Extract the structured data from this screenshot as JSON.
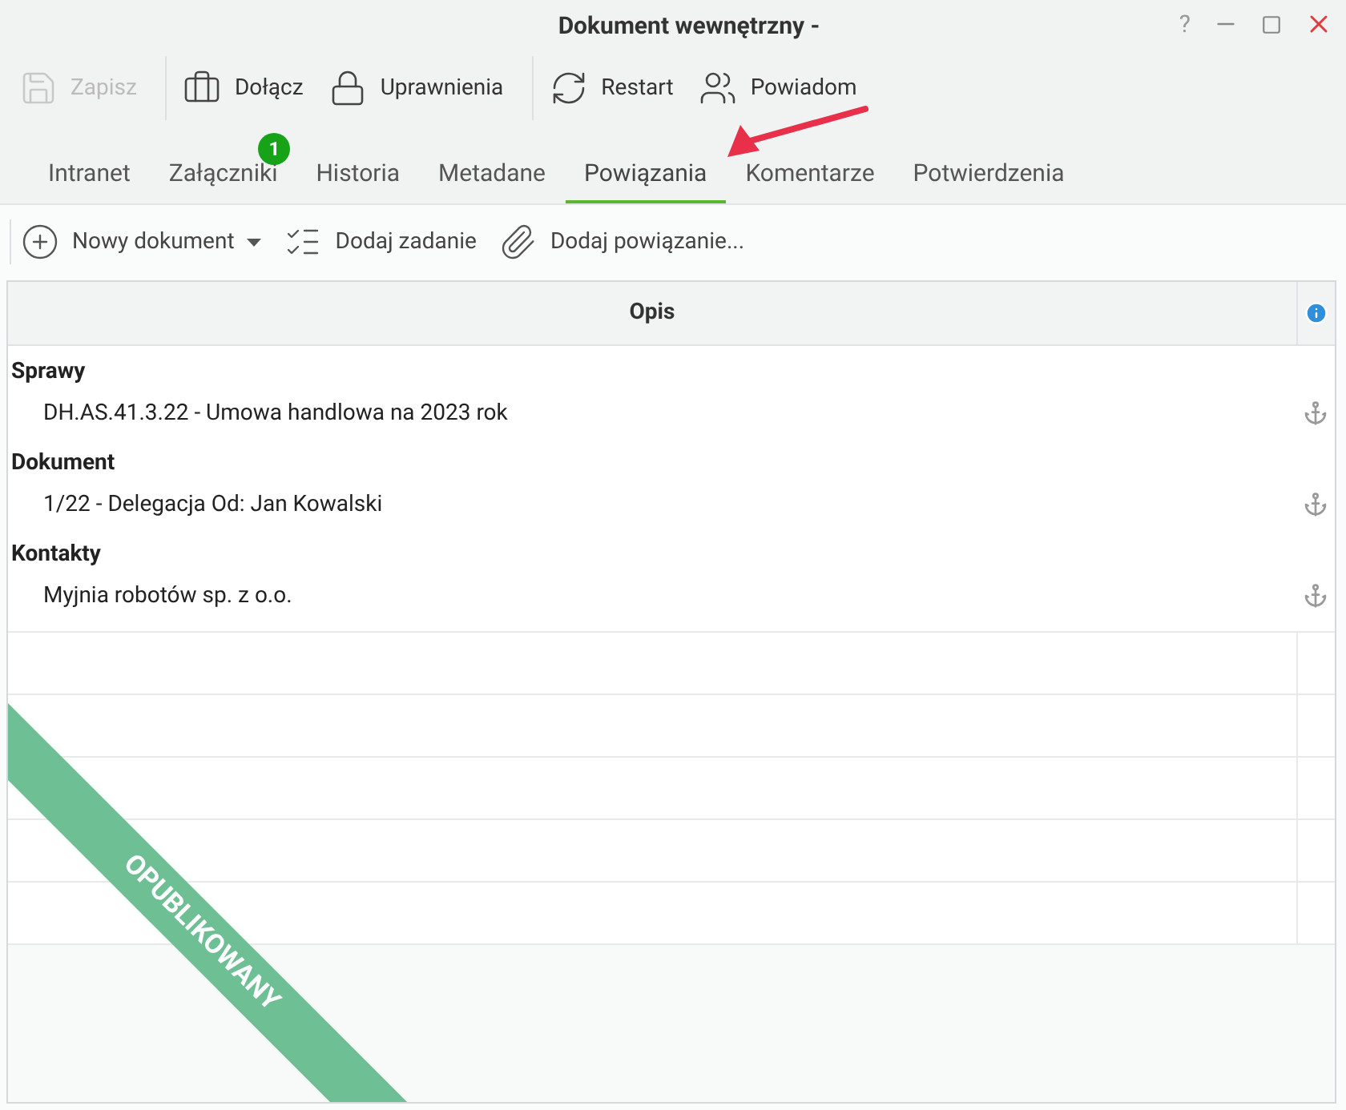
{
  "window": {
    "title": "Dokument wewnętrzny -",
    "help": "?"
  },
  "toolbar": [
    {
      "kind": "save",
      "label": "Zapisz",
      "disabled": true
    },
    {
      "kind": "attach",
      "label": "Dołącz",
      "disabled": false
    },
    {
      "kind": "lock",
      "label": "Uprawnienia",
      "disabled": false
    },
    {
      "kind": "restart",
      "label": "Restart",
      "disabled": false
    },
    {
      "kind": "notify",
      "label": "Powiadom",
      "disabled": false
    }
  ],
  "tabs": [
    {
      "label": "Intranet",
      "selected": false
    },
    {
      "label": "Załączniki",
      "selected": false,
      "badge": "1"
    },
    {
      "label": "Historia",
      "selected": false
    },
    {
      "label": "Metadane",
      "selected": false
    },
    {
      "label": "Powiązania",
      "selected": true
    },
    {
      "label": "Komentarze",
      "selected": false
    },
    {
      "label": "Potwierdzenia",
      "selected": false
    }
  ],
  "actions": [
    {
      "kind": "new",
      "label": "Nowy dokument",
      "dropdown": true
    },
    {
      "kind": "task",
      "label": "Dodaj zadanie",
      "dropdown": false
    },
    {
      "kind": "link",
      "label": "Dodaj powiązanie...",
      "dropdown": false
    }
  ],
  "table": {
    "columns": [
      "Opis"
    ],
    "groups": [
      {
        "title": "Sprawy",
        "items": [
          "DH.AS.41.3.22 - Umowa handlowa na 2023 rok"
        ]
      },
      {
        "title": "Dokument",
        "items": [
          "1/22 - Delegacja Od: Jan Kowalski"
        ]
      },
      {
        "title": "Kontakty",
        "items": [
          "Myjnia robotów sp. z o.o."
        ]
      }
    ]
  },
  "status_ribbon": "OPUBLIKOWANY"
}
